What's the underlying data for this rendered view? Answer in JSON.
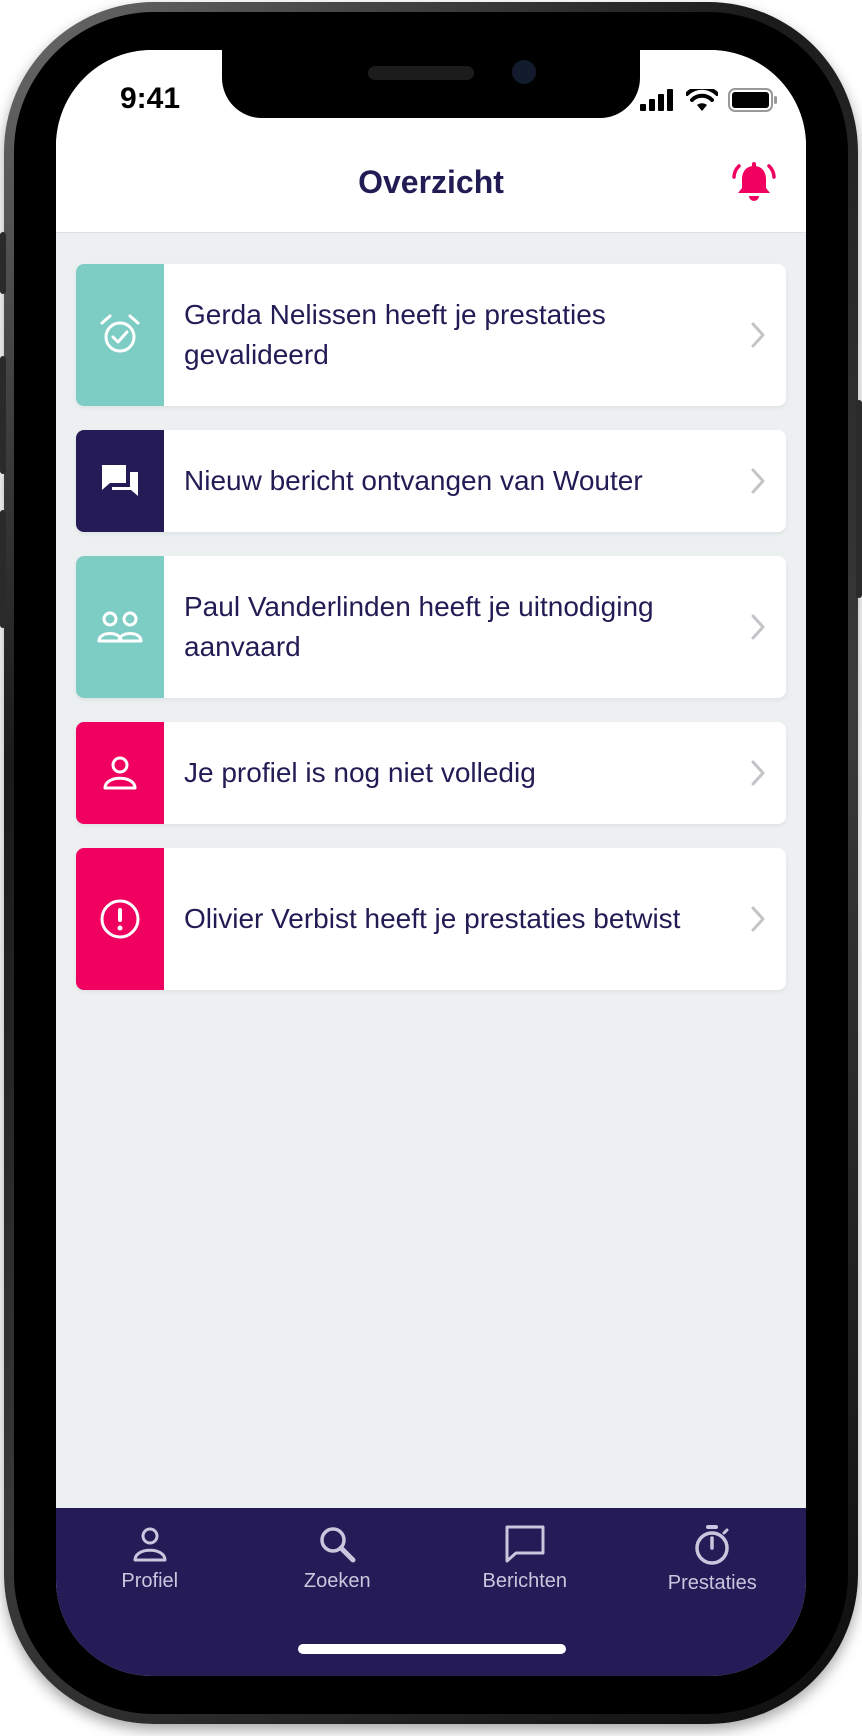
{
  "status_bar": {
    "time": "9:41"
  },
  "header": {
    "title": "Overzicht"
  },
  "notifications": [
    {
      "text": "Gerda Nelissen heeft je prestaties gevalideerd",
      "icon": "alarm-check-icon",
      "color": "#7ecdc4"
    },
    {
      "text": "Nieuw bericht ontvangen van Wouter",
      "icon": "chat-bubbles-icon",
      "color": "#241b57"
    },
    {
      "text": "Paul Vanderlinden heeft je uitnodiging aanvaard",
      "icon": "people-icon",
      "color": "#7ecdc4"
    },
    {
      "text": "Je profiel is nog niet volledig",
      "icon": "person-icon",
      "color": "#f0005f"
    },
    {
      "text": "Olivier Verbist heeft je prestaties betwist",
      "icon": "alert-icon",
      "color": "#f0005f"
    }
  ],
  "tab_bar": {
    "tabs": [
      {
        "label": "Profiel",
        "icon": "person-icon"
      },
      {
        "label": "Zoeken",
        "icon": "search-icon"
      },
      {
        "label": "Berichten",
        "icon": "chat-icon"
      },
      {
        "label": "Prestaties",
        "icon": "stopwatch-icon"
      }
    ]
  },
  "colors": {
    "navy": "#241b57",
    "text": "#221c55",
    "teal": "#7ecdc4",
    "pink": "#f0005f",
    "background": "#ecf0f1"
  }
}
